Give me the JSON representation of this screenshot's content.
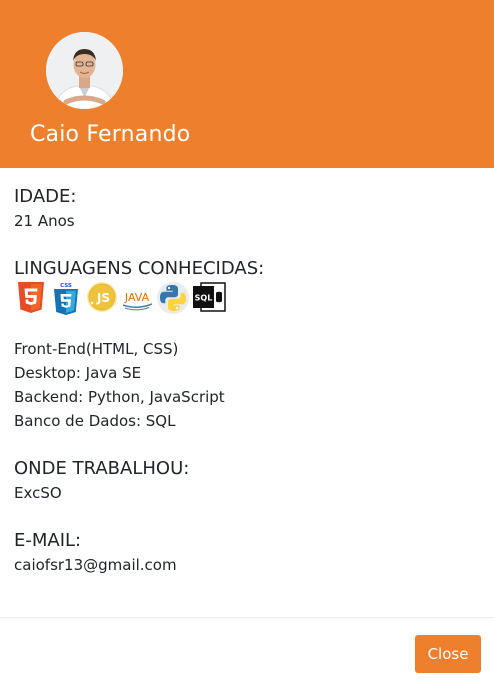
{
  "profile": {
    "name": "Caio Fernando",
    "avatar_icon": "profile-photo"
  },
  "colors": {
    "accent": "#ee7f2d",
    "text": "#212529"
  },
  "sections": {
    "age": {
      "heading": "IDADE:",
      "value": "21 Anos"
    },
    "languages": {
      "heading": "LINGUAGENS CONHECIDAS:",
      "icons": [
        "html5-icon",
        "css3-icon",
        "javascript-icon",
        "java-icon",
        "python-icon",
        "sql-icon"
      ],
      "java_label": "JAVA",
      "sql_label": "SQL",
      "css_label": "CSS",
      "js_label": "JS",
      "lines": [
        "Front-End(HTML, CSS)",
        "Desktop: Java SE",
        "Backend: Python, JavaScript",
        "Banco de Dados: SQL"
      ]
    },
    "work": {
      "heading": "ONDE TRABALHOU:",
      "value": "ExcSO"
    },
    "email": {
      "heading": "E-MAIL:",
      "value": "caiofsr13@gmail.com"
    }
  },
  "footer": {
    "close_label": "Close"
  }
}
